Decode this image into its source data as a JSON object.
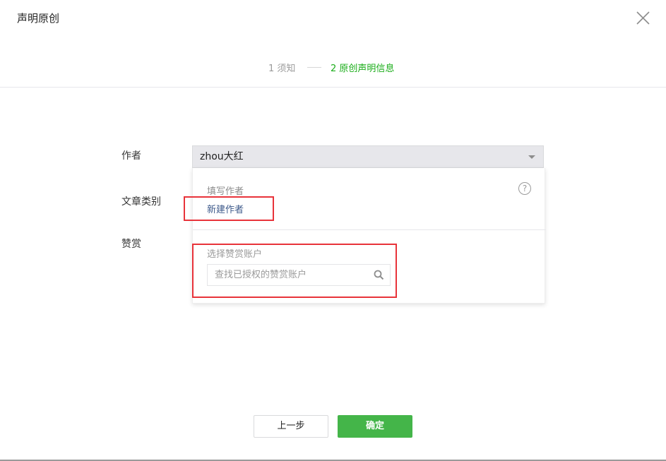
{
  "dialog": {
    "title": "声明原创",
    "close_icon": "close-icon"
  },
  "steps": [
    {
      "label": "1 须知",
      "active": false
    },
    {
      "label": "2 原创声明信息",
      "active": true
    }
  ],
  "form": {
    "author_label": "作者",
    "author_value": "zhou大红",
    "category_label": "文章类别",
    "reward_label": "赞赏"
  },
  "dropdown": {
    "hint": "填写作者",
    "help_icon": "question-circle-icon",
    "help_glyph": "?",
    "new_author": "新建作者",
    "reward_title": "选择赞赏账户",
    "search_placeholder": "查找已授权的赞赏账户",
    "search_icon": "search-icon"
  },
  "buttons": {
    "prev": "上一步",
    "confirm": "确定"
  },
  "colors": {
    "accent_green": "#1aad19",
    "confirm_green": "#44b549",
    "link_blue": "#3e5a8b",
    "highlight_red": "#e8333a"
  }
}
